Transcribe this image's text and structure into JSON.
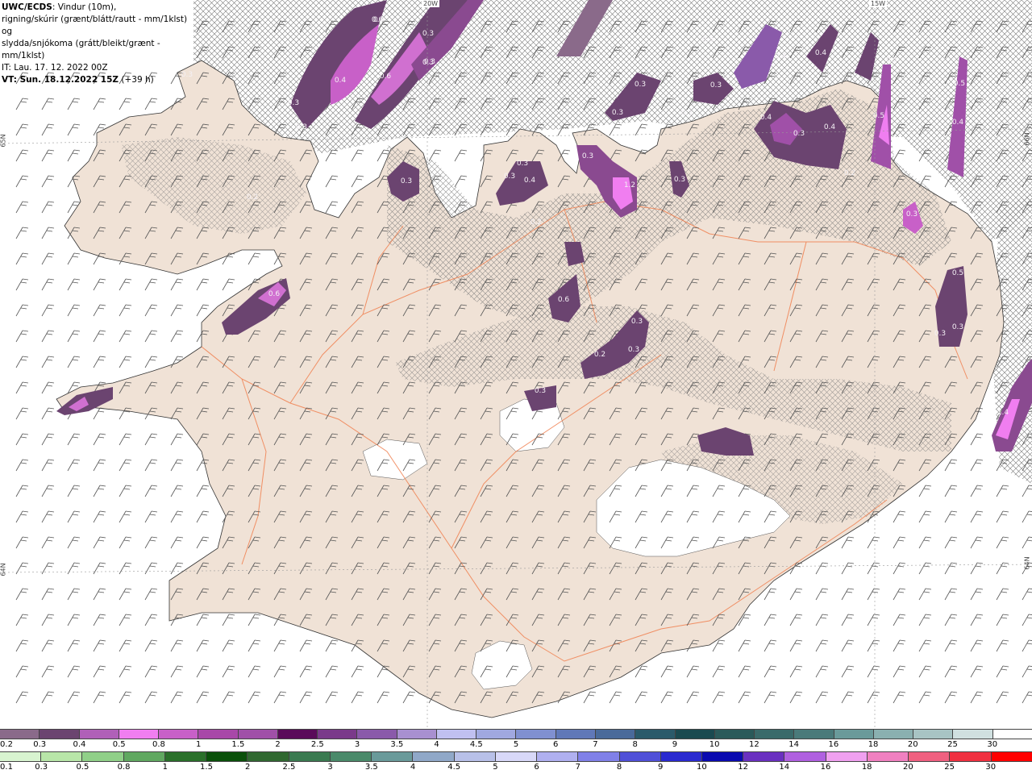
{
  "header": {
    "model": "UWC/ECDS",
    "title_rest": ": Vindur (10m),",
    "line2": "rigning/skúrir (grænt/blátt/rautt - mm/1klst) og",
    "line3": "slydda/snjókoma (grátt/bleikt/grænt - mm/1klst)",
    "init_time": "IT: Lau. 17. 12. 2022 00Z",
    "valid_time_label": "VT: Sun. 18.12.2022 15Z",
    "valid_time_offset": "(+39 h)"
  },
  "graticule": {
    "lon_labels": [
      "20W",
      "15W"
    ],
    "lat_labels": [
      "65N",
      "64N",
      "66N",
      "64N"
    ]
  },
  "snow_labels": [
    {
      "text": "0.3"
    },
    {
      "text": "0.3"
    },
    {
      "text": "0.4"
    },
    {
      "text": "0.6"
    },
    {
      "text": "0.3"
    },
    {
      "text": "0.3"
    },
    {
      "text": "0.6"
    },
    {
      "text": "0.3"
    },
    {
      "text": "0.4"
    },
    {
      "text": "0.3"
    },
    {
      "text": "0.4"
    },
    {
      "text": "0.2"
    },
    {
      "text": "0.3"
    },
    {
      "text": "0.3"
    },
    {
      "text": "0.3"
    },
    {
      "text": "0.3"
    },
    {
      "text": "0.4"
    },
    {
      "text": "0.4"
    },
    {
      "text": "0.5"
    },
    {
      "text": "0.3"
    },
    {
      "text": "0.4"
    },
    {
      "text": "0.3"
    },
    {
      "text": "0.3"
    },
    {
      "text": "1.2"
    },
    {
      "text": "0.3"
    },
    {
      "text": "0.4"
    },
    {
      "text": "0.3"
    },
    {
      "text": "0.3"
    },
    {
      "text": "0.6"
    },
    {
      "text": "0.3"
    },
    {
      "text": "0.2"
    },
    {
      "text": "0.3"
    },
    {
      "text": "0.3"
    },
    {
      "text": "0.3"
    },
    {
      "text": "0.5"
    },
    {
      "text": "0.3"
    },
    {
      "text": "0.3"
    },
    {
      "text": "0.3"
    },
    {
      "text": "0.5"
    },
    {
      "text": "0.4"
    },
    {
      "text": "0.6"
    },
    {
      "text": "1.4"
    },
    {
      "text": "0.2"
    },
    {
      "text": "0.2"
    },
    {
      "text": "0.5"
    }
  ],
  "legend_snow": {
    "labels": [
      "0.2",
      "0.3",
      "0.4",
      "0.5",
      "0.8",
      "1",
      "1.5",
      "2",
      "2.5",
      "3",
      "3.5",
      "4",
      "4.5",
      "5",
      "6",
      "7",
      "8",
      "9",
      "10",
      "12",
      "14",
      "16",
      "18",
      "20",
      "25",
      "30"
    ],
    "colors": [
      "#8a6a8a",
      "#6b4470",
      "#b060b8",
      "#f07ef0",
      "#c860c8",
      "#a848a8",
      "#a050a8",
      "#5a0a5a",
      "#7a3a8a",
      "#8a5aaa",
      "#a890d0",
      "#c0c0f0",
      "#a0a8e0",
      "#8090d0",
      "#6078b8",
      "#4a6a9a",
      "#2a5a6a",
      "#1a4a50",
      "#2a5a5a",
      "#3a6a6a",
      "#4a7a7a",
      "#6a9a9a",
      "#8ab0b0",
      "#a8c4c4",
      "#d0e0e0",
      "#ffffff"
    ]
  },
  "legend_rain": {
    "labels": [
      "0.1",
      "0.3",
      "0.5",
      "0.8",
      "1",
      "1.5",
      "2",
      "2.5",
      "3",
      "3.5",
      "4",
      "4.5",
      "5",
      "6",
      "7",
      "8",
      "9",
      "10",
      "12",
      "14",
      "16",
      "18",
      "20",
      "25",
      "30"
    ],
    "colors": [
      "#d8f4d0",
      "#b8e6a8",
      "#90d088",
      "#60a860",
      "#2a702a",
      "#0a500a",
      "#306830",
      "#3a7a50",
      "#4a8a6a",
      "#6a9a9a",
      "#90a8c8",
      "#b8c0e8",
      "#d8d8f8",
      "#b0b0f0",
      "#8080e8",
      "#5050d8",
      "#2a2ad0",
      "#0a0ab0",
      "#6a30c0",
      "#b060e0",
      "#f0a0f0",
      "#f080c0",
      "#f06080",
      "#f03040",
      "#ff0000"
    ]
  }
}
